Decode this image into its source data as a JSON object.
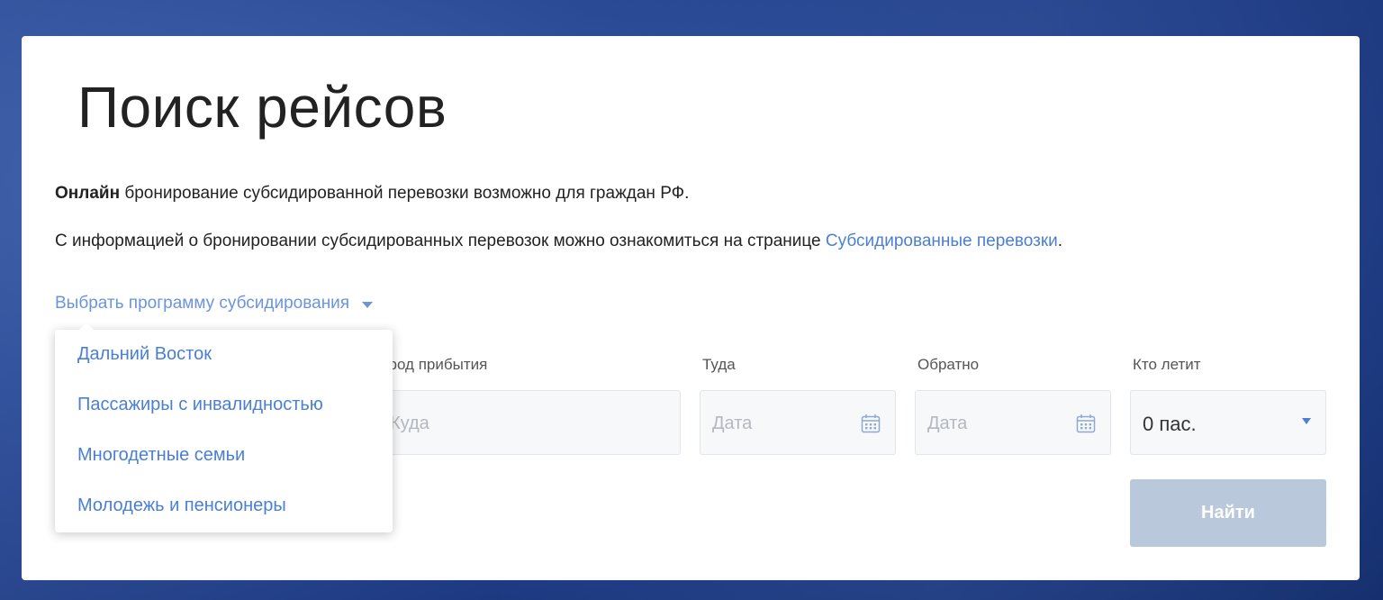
{
  "page": {
    "title": "Поиск рейсов"
  },
  "info": {
    "line1_bold": "Онлайн",
    "line1_rest": " бронирование субсидированной перевозки возможно для граждан РФ.",
    "line2_text": "С информацией о бронировании субсидированных перевозок можно ознакомиться на странице ",
    "line2_link": "Субсидированные перевозки",
    "line2_end": "."
  },
  "program": {
    "toggle_label": "Выбрать программу субсидирования",
    "options": [
      "Дальний Восток",
      "Пассажиры с инвалидностью",
      "Многодетные семьи",
      "Молодежь и пенсионеры"
    ]
  },
  "search": {
    "arrival_label": "Город прибытия",
    "arrival_placeholder": "Куда",
    "depart_label": "Туда",
    "depart_placeholder": "Дата",
    "return_label": "Обратно",
    "return_placeholder": "Дата",
    "passengers_label": "Кто летит",
    "passengers_value": "0 пас.",
    "find_button": "Найти"
  },
  "colors": {
    "link": "#4a7fd4",
    "button_disabled": "#b9c8da",
    "background": "#2a4a96"
  }
}
